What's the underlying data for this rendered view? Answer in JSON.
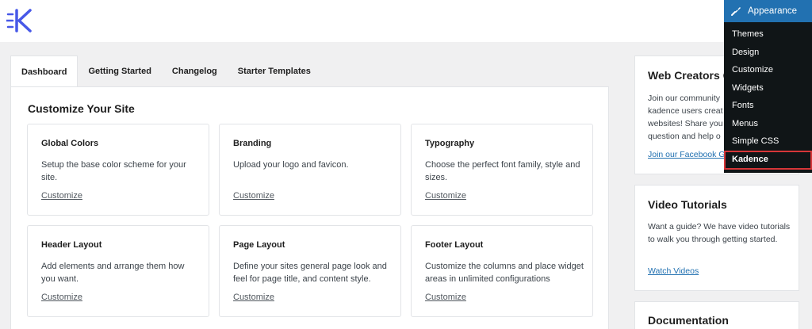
{
  "logo": {
    "icon": "kadence-logo-icon",
    "color": "#4758e8"
  },
  "tabs": [
    {
      "label": "Dashboard"
    },
    {
      "label": "Getting Started"
    },
    {
      "label": "Changelog"
    },
    {
      "label": "Starter Templates"
    }
  ],
  "main": {
    "title": "Customize Your Site",
    "cards": [
      {
        "title": "Global Colors",
        "desc": "Setup the base color scheme for your site.",
        "link": "Customize"
      },
      {
        "title": "Branding",
        "desc": "Upload your logo and favicon.",
        "link": "Customize"
      },
      {
        "title": "Typography",
        "desc": "Choose the perfect font family, style and sizes.",
        "link": "Customize"
      },
      {
        "title": "Header Layout",
        "desc": "Add elements and arrange them how you want.",
        "link": "Customize"
      },
      {
        "title": "Page Layout",
        "desc": "Define your sites general page look and feel for page title, and content style.",
        "link": "Customize"
      },
      {
        "title": "Footer Layout",
        "desc": "Customize the columns and place widget areas in unlimited configurations",
        "link": "Customize"
      }
    ]
  },
  "sidebar": {
    "community": {
      "title": "Web Creators C",
      "desc": "Join our community kadence users creat websites! Share you question and help o",
      "link": "Join our Facebook G"
    },
    "video": {
      "title": "Video Tutorials",
      "desc": "Want a guide? We have video tutorials to walk you through getting started.",
      "link": "Watch Videos"
    },
    "docs": {
      "title": "Documentation"
    }
  },
  "admin_menu": {
    "header": "Appearance",
    "header_icon": "paintbrush-icon",
    "items": [
      "Themes",
      "Design",
      "Customize",
      "Widgets",
      "Fonts",
      "Menus",
      "Simple CSS",
      "Kadence"
    ],
    "current": "Kadence",
    "accent": "#2271b1",
    "highlight_color": "#d63638"
  }
}
